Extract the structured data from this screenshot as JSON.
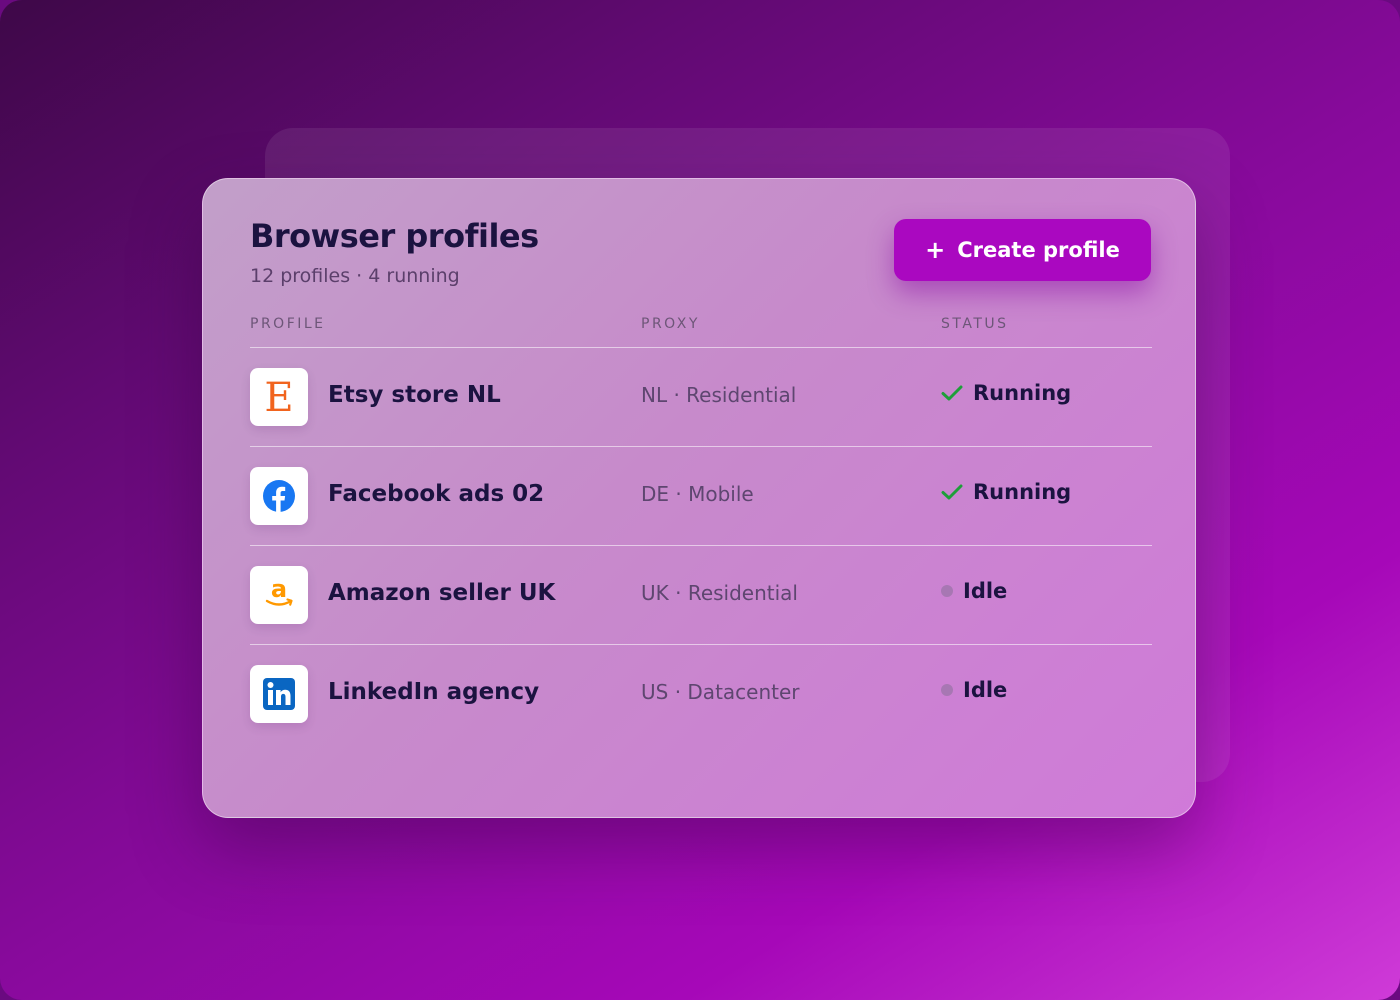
{
  "header": {
    "title": "Browser profiles",
    "subtitle": "12 profiles · 4 running",
    "create_button": {
      "icon": "plus-icon",
      "label": "Create profile"
    }
  },
  "columns": [
    "PROFILE",
    "PROXY",
    "STATUS"
  ],
  "rows": [
    {
      "name": "Etsy store NL",
      "icon": "etsy-icon",
      "proxy": "NL · Residential",
      "status": "Running",
      "status_icon": "check-icon"
    },
    {
      "name": "Facebook ads 02",
      "icon": "facebook-icon",
      "proxy": "DE · Mobile",
      "status": "Running",
      "status_icon": "check-icon"
    },
    {
      "name": "Amazon seller UK",
      "icon": "amazon-icon",
      "proxy": "UK · Residential",
      "status": "Idle",
      "status_icon": "dot-icon"
    },
    {
      "name": "LinkedIn agency",
      "icon": "linkedin-icon",
      "proxy": "US · Datacenter",
      "status": "Idle",
      "status_icon": "dot-icon"
    }
  ],
  "colors": {
    "accent": "#aa08c0",
    "title_text": "#1b1340",
    "running_check": "#1e9e3a",
    "idle_dot": "#a777b3",
    "etsy_brand": "#f1641e",
    "facebook_brand": "#1877f2",
    "amazon_brand": "#ff9900",
    "linkedin_brand": "#0a66c2"
  }
}
